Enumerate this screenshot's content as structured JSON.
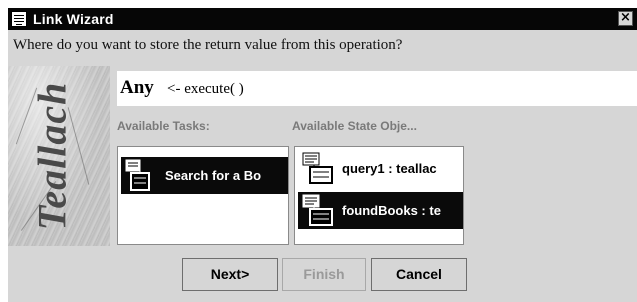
{
  "window": {
    "title": "Link Wizard",
    "close_glyph": "×"
  },
  "prompt": "Where do you want to store the return value from this operation?",
  "side_image": {
    "text": "Teallach"
  },
  "expression": {
    "type": "Any",
    "call": "<- execute( )"
  },
  "tasks": {
    "label": "Available Tasks:",
    "items": [
      {
        "text": "Search for a Bo",
        "selected": true,
        "icon": "task-icon"
      }
    ]
  },
  "state_objects": {
    "label": "Available State Obje...",
    "items": [
      {
        "text": "query1 : teallac",
        "selected": false,
        "icon": "state-object-icon"
      },
      {
        "text": "foundBooks : te",
        "selected": true,
        "icon": "state-object-icon"
      }
    ]
  },
  "buttons": {
    "next": "Next>",
    "finish": "Finish",
    "cancel": "Cancel",
    "finish_enabled": false
  }
}
